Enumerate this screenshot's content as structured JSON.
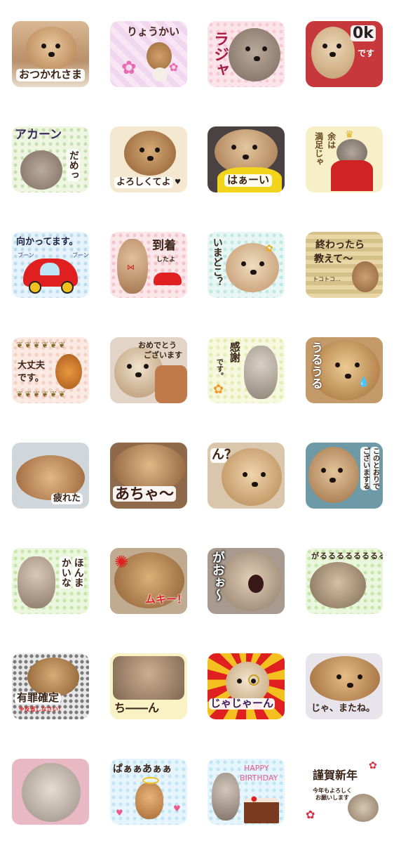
{
  "stickers": [
    {
      "id": "s1",
      "texts": [
        "おつかれさま"
      ]
    },
    {
      "id": "s2",
      "texts": [
        "りょうかい"
      ]
    },
    {
      "id": "s3",
      "texts": [
        "ラジャ"
      ]
    },
    {
      "id": "s4",
      "texts": [
        "0k",
        "です"
      ]
    },
    {
      "id": "s5",
      "texts": [
        "アカーン",
        "だめっ"
      ]
    },
    {
      "id": "s6",
      "texts": [
        "よろしくてよ"
      ]
    },
    {
      "id": "s7",
      "texts": [
        "はぁーい"
      ]
    },
    {
      "id": "s8",
      "texts": [
        "余は",
        "満足じゃ"
      ]
    },
    {
      "id": "s9",
      "texts": [
        "向かってます。",
        "ブーン",
        "ブーン"
      ]
    },
    {
      "id": "s10",
      "texts": [
        "到着",
        "したよ"
      ]
    },
    {
      "id": "s11",
      "texts": [
        "いまどこ？"
      ]
    },
    {
      "id": "s12",
      "texts": [
        "終わったら",
        "教えて〜",
        "トコトコ…"
      ]
    },
    {
      "id": "s13",
      "texts": [
        "大丈夫",
        "です。"
      ]
    },
    {
      "id": "s14",
      "texts": [
        "おめでとう",
        "ございます"
      ]
    },
    {
      "id": "s15",
      "texts": [
        "感謝",
        "です。"
      ]
    },
    {
      "id": "s16",
      "texts": [
        "うるうる"
      ]
    },
    {
      "id": "s17",
      "texts": [
        "疲れた"
      ]
    },
    {
      "id": "s18",
      "texts": [
        "あちゃ〜"
      ]
    },
    {
      "id": "s19",
      "texts": [
        "ん？"
      ]
    },
    {
      "id": "s20",
      "texts": [
        "このとおりで",
        "ございまする"
      ]
    },
    {
      "id": "s21",
      "texts": [
        "ほんま",
        "かいな"
      ]
    },
    {
      "id": "s22",
      "texts": [
        "ムキー！"
      ]
    },
    {
      "id": "s23",
      "texts": [
        "がおぉ〜"
      ]
    },
    {
      "id": "s24",
      "texts": [
        "がるるるるるるるる"
      ]
    },
    {
      "id": "s25",
      "texts": [
        "有罪確定",
        "※反省しなさい！"
      ]
    },
    {
      "id": "s26",
      "texts": [
        "ち――ん"
      ]
    },
    {
      "id": "s27",
      "texts": [
        "じゃじゃーん"
      ]
    },
    {
      "id": "s28",
      "texts": [
        "じゃ、またね。"
      ]
    },
    {
      "id": "s29",
      "texts": []
    },
    {
      "id": "s30",
      "texts": [
        "ぱぁぁあぁぁ"
      ]
    },
    {
      "id": "s31",
      "texts": [
        "HAPPY",
        "BIRTHDAY"
      ]
    },
    {
      "id": "s32",
      "texts": [
        "謹賀新年",
        "今年もよろしく",
        "お願いします"
      ]
    }
  ],
  "colors": {
    "fur_light": "#e6c79c",
    "fur_mid": "#c9955f",
    "fur_dark": "#8a5a34",
    "fur_grey": "#b8a89a",
    "accent_red": "#e02020",
    "accent_pink": "#e85b8a"
  }
}
